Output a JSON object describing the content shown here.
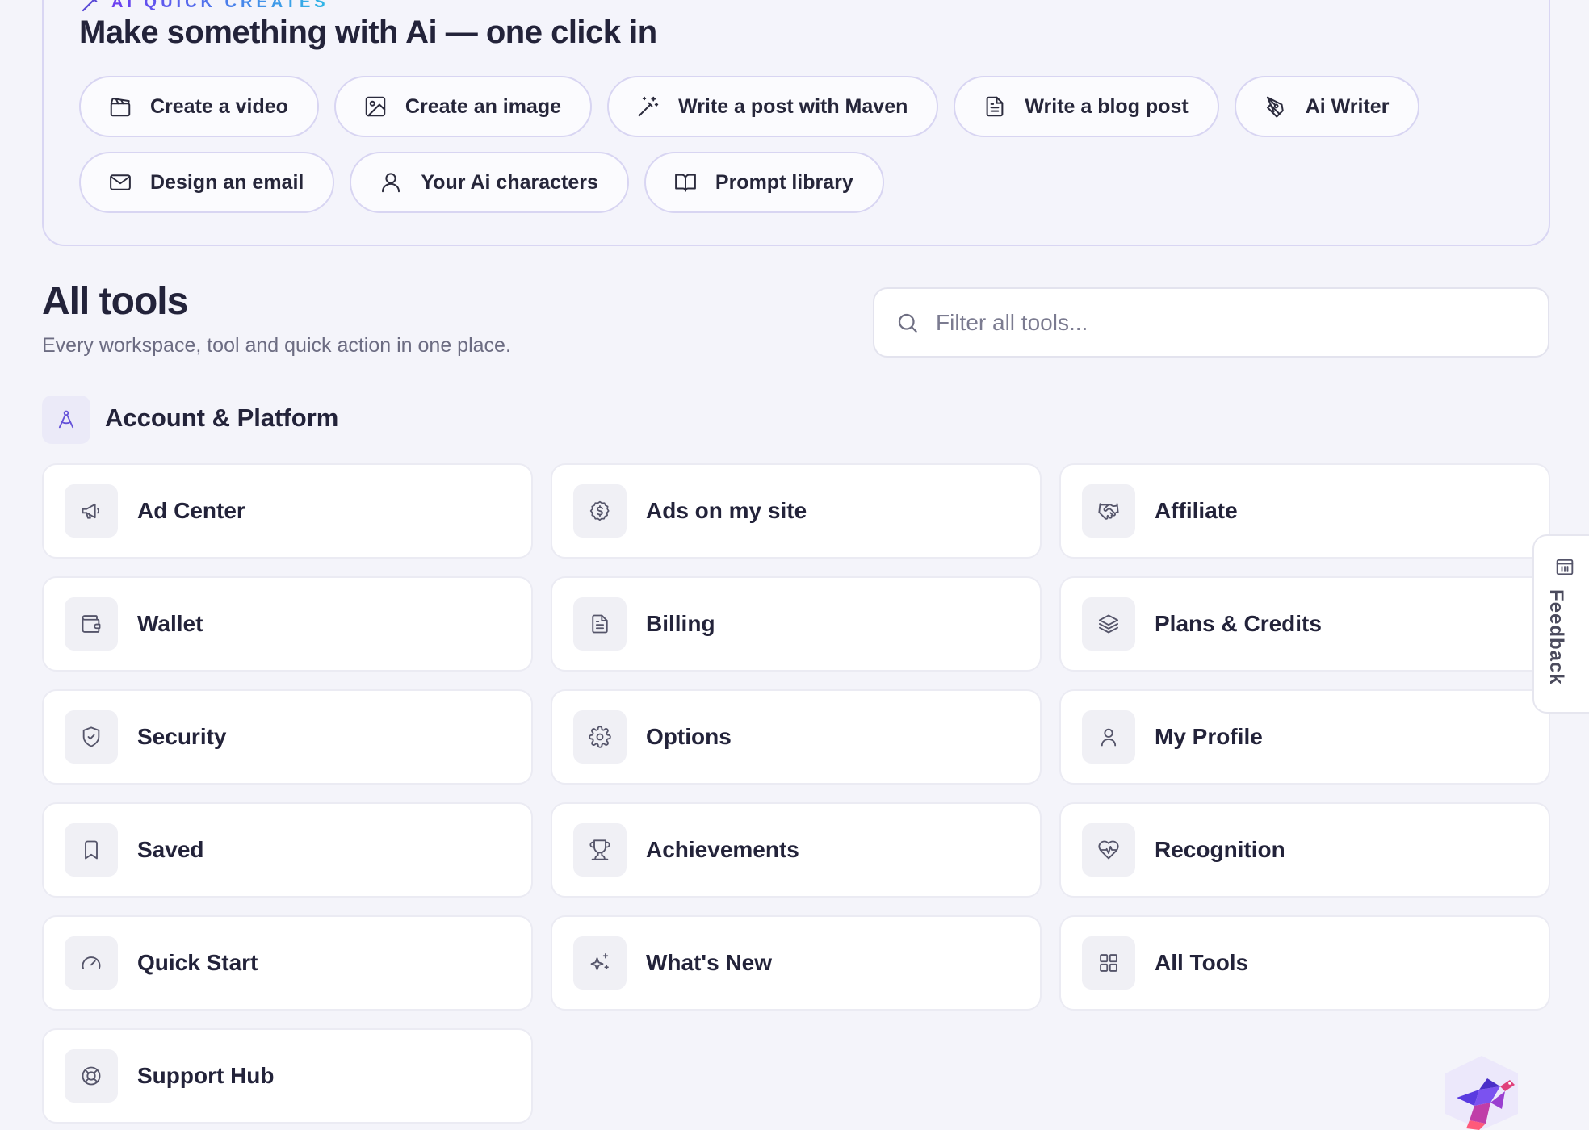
{
  "quick_creates": {
    "eyebrow": "AI QUICK CREATES",
    "title": "Make something with Ai — one click in",
    "actions_row1": [
      {
        "label": "Create a video",
        "icon": "clapperboard-icon"
      },
      {
        "label": "Create an image",
        "icon": "image-icon"
      },
      {
        "label": "Write a post with Maven",
        "icon": "magic-wand-icon"
      },
      {
        "label": "Write a blog post",
        "icon": "document-icon"
      },
      {
        "label": "Ai Writer",
        "icon": "pen-tool-icon"
      }
    ],
    "actions_row2": [
      {
        "label": "Design an email",
        "icon": "mail-icon"
      },
      {
        "label": "Your Ai characters",
        "icon": "user-icon"
      },
      {
        "label": "Prompt library",
        "icon": "book-open-icon"
      }
    ]
  },
  "all_tools": {
    "title": "All tools",
    "subtitle": "Every workspace, tool and quick action in one place.",
    "filter_placeholder": "Filter all tools..."
  },
  "section": {
    "title": "Account & Platform",
    "icon": "compass-icon",
    "tools": [
      {
        "label": "Ad Center",
        "icon": "megaphone-icon"
      },
      {
        "label": "Ads on my site",
        "icon": "dollar-badge-icon"
      },
      {
        "label": "Affiliate",
        "icon": "handshake-icon"
      },
      {
        "label": "Wallet",
        "icon": "wallet-icon"
      },
      {
        "label": "Billing",
        "icon": "receipt-icon"
      },
      {
        "label": "Plans & Credits",
        "icon": "layers-icon"
      },
      {
        "label": "Security",
        "icon": "shield-check-icon"
      },
      {
        "label": "Options",
        "icon": "gear-icon"
      },
      {
        "label": "My Profile",
        "icon": "user-icon"
      },
      {
        "label": "Saved",
        "icon": "bookmark-icon"
      },
      {
        "label": "Achievements",
        "icon": "trophy-icon"
      },
      {
        "label": "Recognition",
        "icon": "heart-pulse-icon"
      },
      {
        "label": "Quick Start",
        "icon": "gauge-icon"
      },
      {
        "label": "What's New",
        "icon": "sparkles-icon"
      },
      {
        "label": "All Tools",
        "icon": "grid-icon"
      },
      {
        "label": "Support Hub",
        "icon": "lifebuoy-icon"
      }
    ]
  },
  "feedback": {
    "label": "Feedback",
    "icon": "feedback-icon"
  },
  "mascot": {
    "icon": "bird-mascot-icon"
  },
  "colors": {
    "background": "#f4f4fa",
    "card_border": "#d9d6f3",
    "accent_start": "#6d3df0",
    "accent_end": "#2fb8e6",
    "text": "#23233a",
    "muted": "#6c6c82"
  }
}
